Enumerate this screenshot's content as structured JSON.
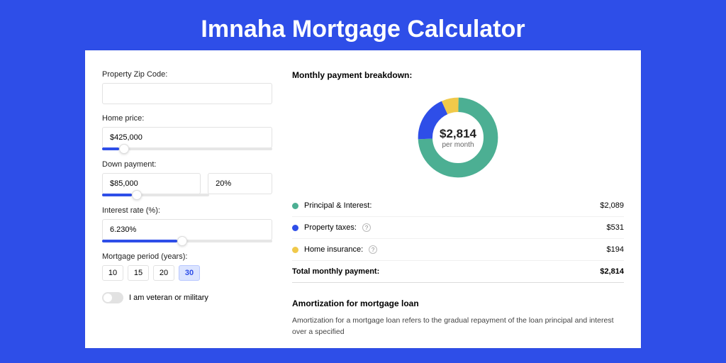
{
  "title": "Imnaha Mortgage Calculator",
  "form": {
    "zip_label": "Property Zip Code:",
    "zip_value": "",
    "home_price_label": "Home price:",
    "home_price_value": "$425,000",
    "home_price_slider_pct": 10,
    "down_payment_label": "Down payment:",
    "down_payment_value": "$85,000",
    "down_payment_pct_value": "20%",
    "down_payment_slider_pct": 28,
    "interest_label": "Interest rate (%):",
    "interest_value": "6.230%",
    "interest_slider_pct": 44,
    "period_label": "Mortgage period (years):",
    "period_options": [
      "10",
      "15",
      "20",
      "30"
    ],
    "period_selected": "30",
    "veteran_label": "I am veteran or military",
    "veteran_value": false
  },
  "breakdown": {
    "heading": "Monthly payment breakdown:",
    "center_amount": "$2,814",
    "center_sub": "per month",
    "items": [
      {
        "label": "Principal & Interest:",
        "value": "$2,089",
        "color": "g",
        "help": false
      },
      {
        "label": "Property taxes:",
        "value": "$531",
        "color": "b",
        "help": true
      },
      {
        "label": "Home insurance:",
        "value": "$194",
        "color": "y",
        "help": true
      }
    ],
    "total_label": "Total monthly payment:",
    "total_value": "$2,814"
  },
  "chart_data": {
    "type": "pie",
    "title": "Monthly payment breakdown",
    "categories": [
      "Principal & Interest",
      "Property taxes",
      "Home insurance"
    ],
    "values": [
      2089,
      531,
      194
    ],
    "colors": [
      "#4caf93",
      "#2e4ee8",
      "#f0c94a"
    ],
    "total": 2814,
    "unit": "USD"
  },
  "amortization": {
    "heading": "Amortization for mortgage loan",
    "text": "Amortization for a mortgage loan refers to the gradual repayment of the loan principal and interest over a specified"
  }
}
